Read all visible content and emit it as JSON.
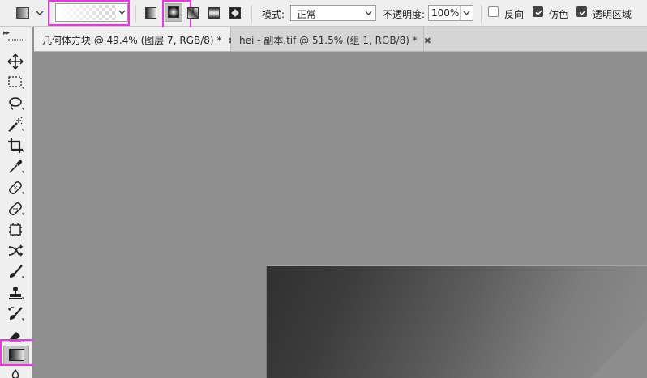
{
  "options_bar": {
    "tool_preset_icon": "gradient-tool-preset-icon",
    "gradient_picker": "transparent-to-white-gradient-swatch",
    "gradient_types": [
      "linear",
      "radial",
      "angle",
      "reflected",
      "diamond"
    ],
    "selected_gradient_type": "radial",
    "mode_label": "模式:",
    "mode_value": "正常",
    "opacity_label": "不透明度:",
    "opacity_value": "100%",
    "reverse_label": "反向",
    "reverse_checked": false,
    "dither_label": "仿色",
    "dither_checked": true,
    "transparency_label": "透明区域",
    "transparency_checked": true
  },
  "tabs": [
    {
      "title": "几何体方块 @ 49.4% (图层 7, RGB/8) *",
      "close": "✖",
      "active": true
    },
    {
      "title": "hei - 副本.tif @ 51.5% (组 1, RGB/8) *",
      "close": "✖",
      "active": false
    }
  ],
  "toolbar": {
    "collapse_glyph": "▸▸",
    "tools": [
      "move-tool",
      "rectangular-marquee-tool",
      "lasso-tool",
      "magic-wand-tool",
      "crop-tool",
      "eyedropper-tool",
      "spot-healing-brush-tool",
      "patch-tool",
      "content-aware-move-tool",
      "red-eye-tool",
      "brush-tool",
      "clone-stamp-tool",
      "history-brush-tool",
      "eraser-tool",
      "gradient-tool",
      "blur-tool"
    ],
    "selected_tool": "gradient-tool"
  },
  "highlight_color": "#f230e8"
}
